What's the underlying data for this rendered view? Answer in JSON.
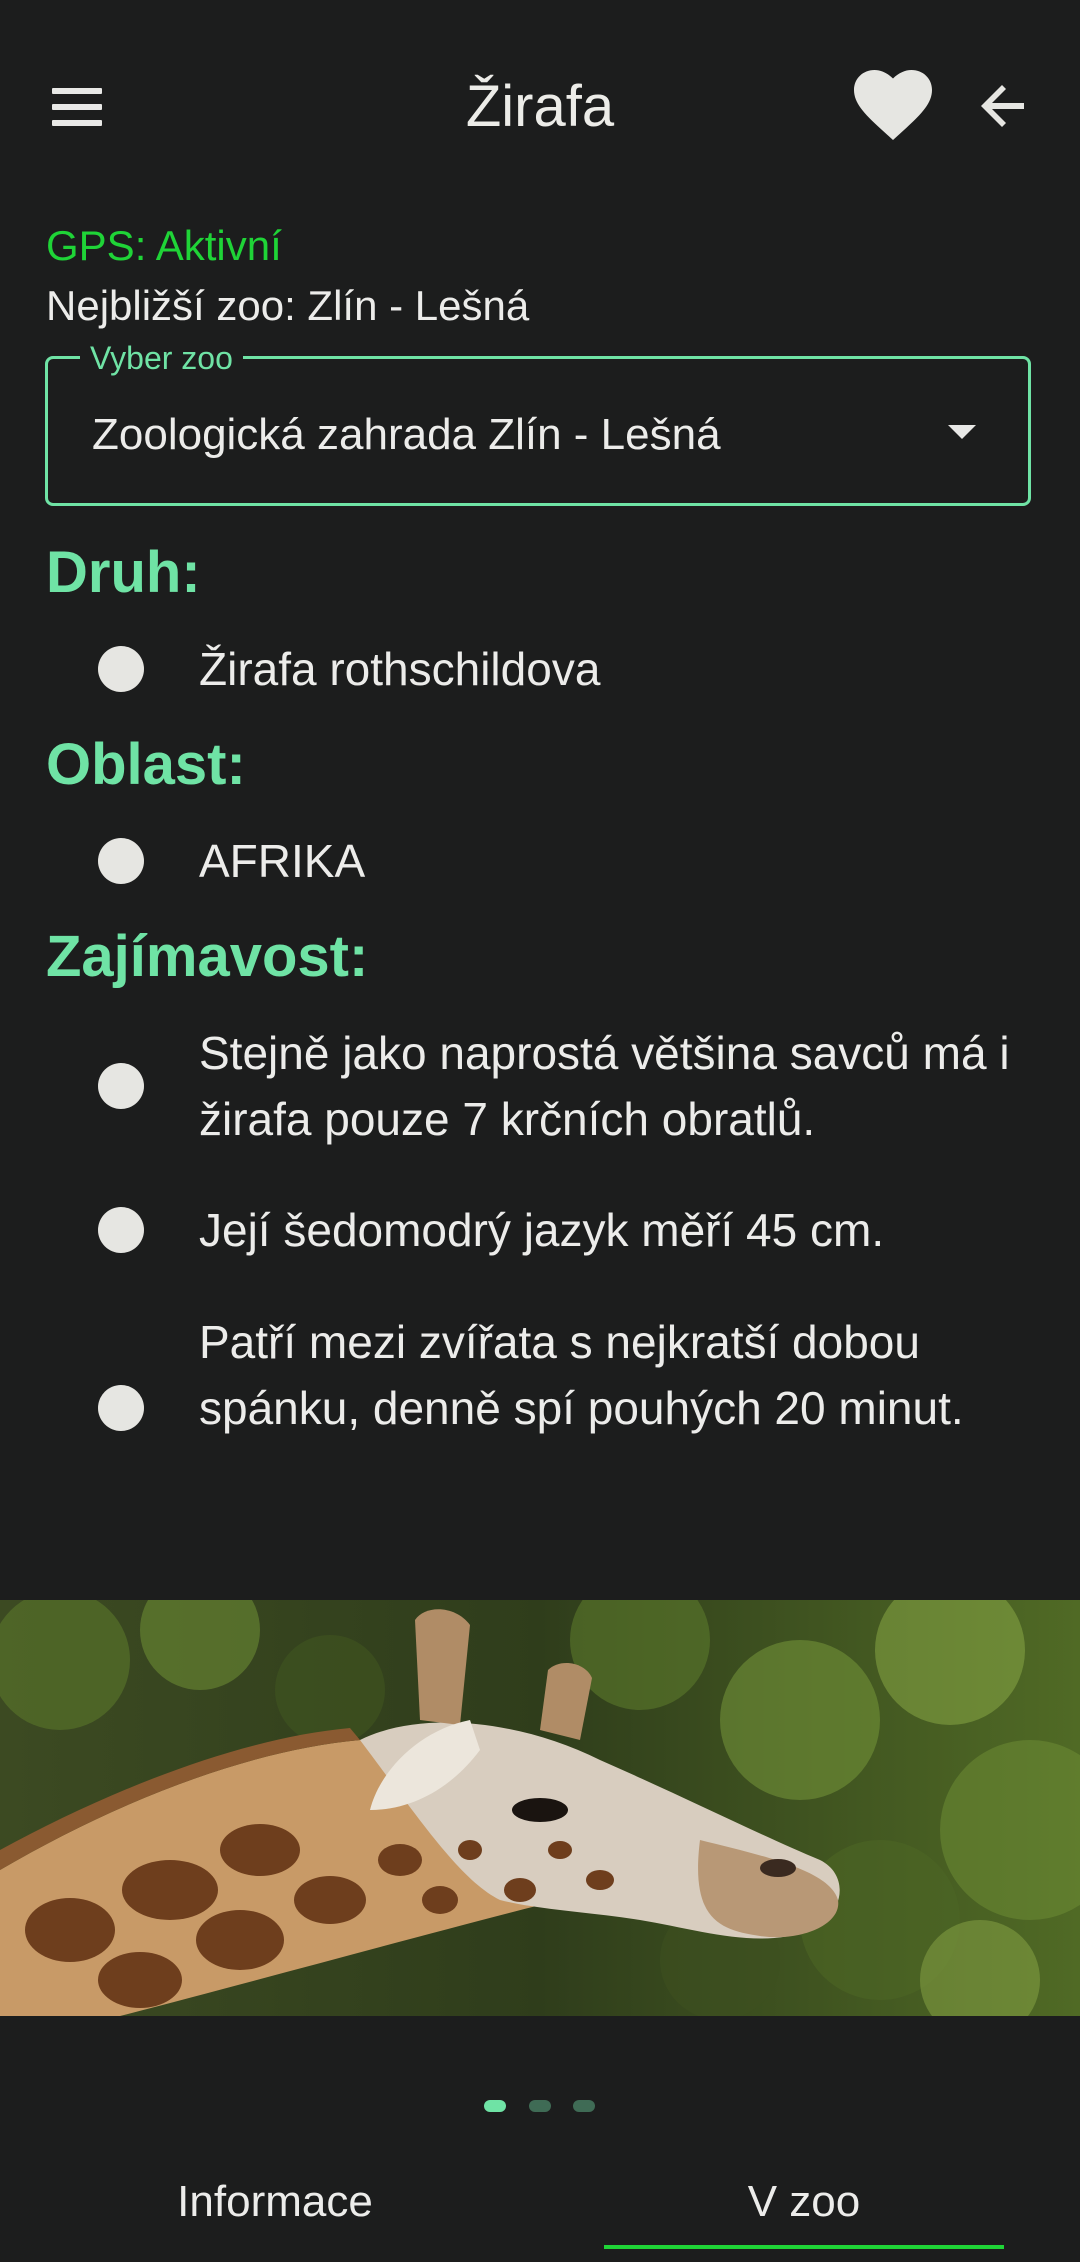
{
  "app_bar": {
    "title": "Žirafa",
    "menu_icon": "hamburger-menu-icon",
    "favorite_icon": "heart-icon",
    "back_icon": "arrow-back-icon"
  },
  "gps": {
    "status": "GPS: Aktivní",
    "status_color": "#1fd437",
    "nearest_zoo": "Nejbližší zoo: Zlín - Lešná"
  },
  "zoo_select": {
    "label": "Vyber zoo",
    "value": "Zoologická zahrada Zlín - Lešná",
    "accent_color": "#6fe3a5"
  },
  "sections": {
    "species": {
      "heading": "Druh:",
      "items": [
        "Žirafa rothschildova"
      ]
    },
    "region": {
      "heading": "Oblast:",
      "items": [
        "AFRIKA"
      ]
    },
    "facts": {
      "heading": "Zajímavost:",
      "items": [
        "Stejně jako naprostá většina savců má i žirafa pouze 7 krčních obratlů.",
        "Její šedomodrý jazyk měří 45 cm.",
        "Patří mezi zvířata s nejkratší dobou spánku, denně spí pouhých 20 minut."
      ]
    }
  },
  "carousel": {
    "pages": 3,
    "active_page": 1,
    "image_subject": "giraffe"
  },
  "tabs": [
    {
      "label": "Informace",
      "selected": false
    },
    {
      "label": "V zoo",
      "selected": true
    }
  ]
}
